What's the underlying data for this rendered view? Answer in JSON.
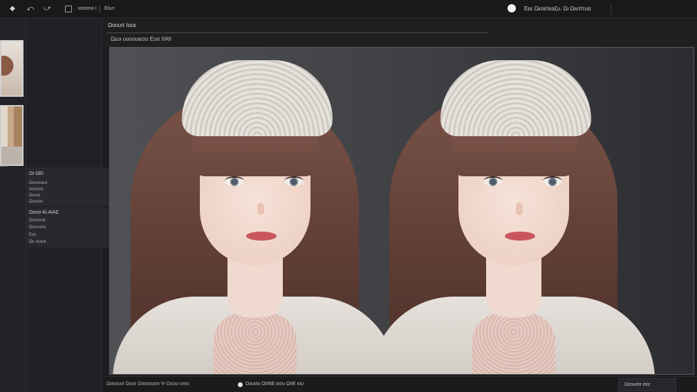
{
  "toolbar": {
    "label_1": "ιασοονι Ι",
    "label_2": "Ελυτ",
    "status_text": "Εεε Ωεοιπεαζυ. Ωι Ωιυπτυα"
  },
  "sidebar": {
    "panel_1": {
      "title": "ΩΙ ΩΕΙ",
      "items": [
        "Ωσνσοεσ",
        "ιεουσοι",
        "Ωουιε",
        "Ωουσσ"
      ]
    },
    "panel_2": {
      "title": "Ωουσ ΑΙ.ΑΙΑΣ",
      "items": [
        "Ωσουυιε",
        "Ωσνυιπε",
        "Εεε",
        "Ωε ουιυιι"
      ]
    },
    "left_label": "Ωευ"
  },
  "main": {
    "title": "Ωοουιτ Ιαυε",
    "subtitle": "Ωευι ουοουιεσυ Ευιτ ΙΙΑΙΙ"
  },
  "canvas": {
    "images": [
      {
        "alt": "portrait-left"
      },
      {
        "alt": "portrait-right"
      }
    ]
  },
  "statusbar": {
    "left_text": "Ωοσουσ Ωουτ Ωσσιουσσ Ψ Ωεουι οπει",
    "mid_text": "Ωουσο ΟΙΙΝΕ ιεσυ ΩΙΙΕ ιου",
    "button_label": "Ωεουσσ ιτεε"
  },
  "colors": {
    "background": "#1c1d1f",
    "canvas_bg": "#505154",
    "accent_white": "#f2f2f2"
  }
}
